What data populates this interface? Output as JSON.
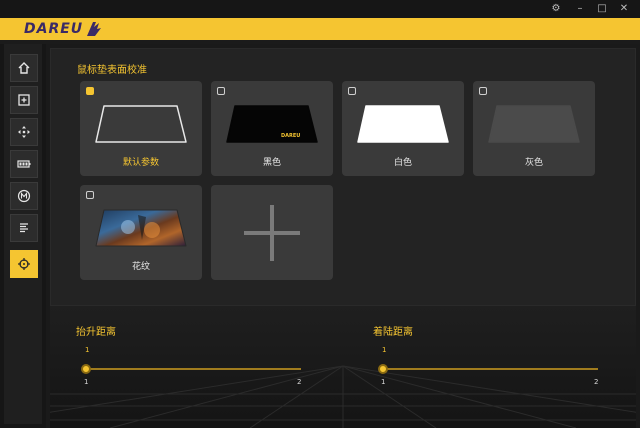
{
  "window": {
    "settings_icon": "gear-icon",
    "minimize": "–",
    "maximize": "□",
    "close": "✕"
  },
  "brand": {
    "logo_text": "DAREU",
    "accent": "#f5c531"
  },
  "sidebar": {
    "items": [
      {
        "icon": "home-icon"
      },
      {
        "icon": "plus-square-icon"
      },
      {
        "icon": "move-icon"
      },
      {
        "icon": "battery-icon"
      },
      {
        "icon": "macro-m-icon"
      },
      {
        "icon": "text-lines-icon"
      },
      {
        "icon": "crosshair-icon",
        "active": true
      }
    ]
  },
  "surface": {
    "title": "鼠标垫表面校准",
    "pads": [
      {
        "label": "默认参数",
        "selected": true
      },
      {
        "label": "黑色",
        "selected": false
      },
      {
        "label": "白色",
        "selected": false
      },
      {
        "label": "灰色",
        "selected": false
      },
      {
        "label": "花纹",
        "selected": false
      }
    ],
    "add_icon": "plus-icon"
  },
  "lift": {
    "title": "抬升距离",
    "value": "1",
    "min": "1",
    "max": "2"
  },
  "landing": {
    "title": "着陆距离",
    "value": "1",
    "min": "1",
    "max": "2"
  }
}
